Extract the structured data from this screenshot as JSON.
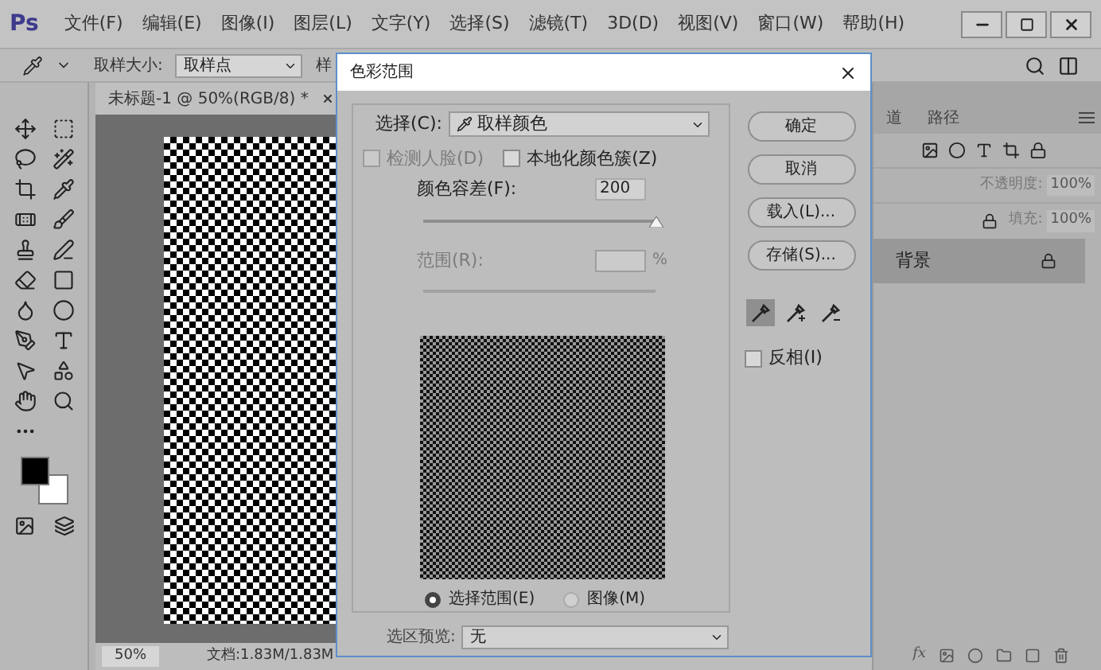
{
  "app": {
    "logo": "Ps",
    "menu": [
      "文件(F)",
      "编辑(E)",
      "图像(I)",
      "图层(L)",
      "文字(Y)",
      "选择(S)",
      "滤镜(T)",
      "3D(D)",
      "视图(V)",
      "窗口(W)",
      "帮助(H)"
    ]
  },
  "options_bar": {
    "sample_size_label": "取样大小:",
    "sample_size_value": "取样点",
    "sample_label": "样"
  },
  "document": {
    "tab": "未标题-1 @ 50%(RGB/8) *",
    "zoom": "50%",
    "doc_info": "文档:1.83M/1.83M"
  },
  "layers_panel": {
    "tabs": [
      {
        "label": "道",
        "selected": false
      },
      {
        "label": "路径",
        "selected": false
      }
    ],
    "opacity_label": "不透明度:",
    "opacity": "100%",
    "fill_label": "填充:",
    "fill": "100%",
    "layers": [
      {
        "name": "背景",
        "selected": true,
        "locked": true
      }
    ],
    "fx_label": "fx"
  },
  "dialog": {
    "title": "色彩范围",
    "select_label": "选择(C):",
    "select_value": "取样颜色",
    "detect_faces": {
      "label": "检测人脸(D)",
      "checked": false,
      "disabled": true
    },
    "localized": {
      "label": "本地化颜色簇(Z)",
      "checked": false,
      "disabled": false
    },
    "fuzziness_label": "颜色容差(F):",
    "fuzziness_value": "200",
    "fuzziness": {
      "level": 1
    },
    "range_label": "范围(R):",
    "range_unit": "%",
    "range_disabled": true,
    "view": [
      {
        "label": "选择范围(E)",
        "selected": true
      },
      {
        "label": "图像(M)",
        "selected": false
      }
    ],
    "preview_label": "选区预览:",
    "preview_value": "无",
    "buttons": [
      "确定",
      "取消",
      "载入(L)...",
      "存储(S)..."
    ],
    "eyedroppers": [
      {
        "kind": "sample",
        "selected": true
      },
      {
        "kind": "add",
        "selected": false
      },
      {
        "kind": "subtract",
        "selected": false
      }
    ],
    "invert": {
      "label": "反相(I)",
      "checked": false
    }
  }
}
